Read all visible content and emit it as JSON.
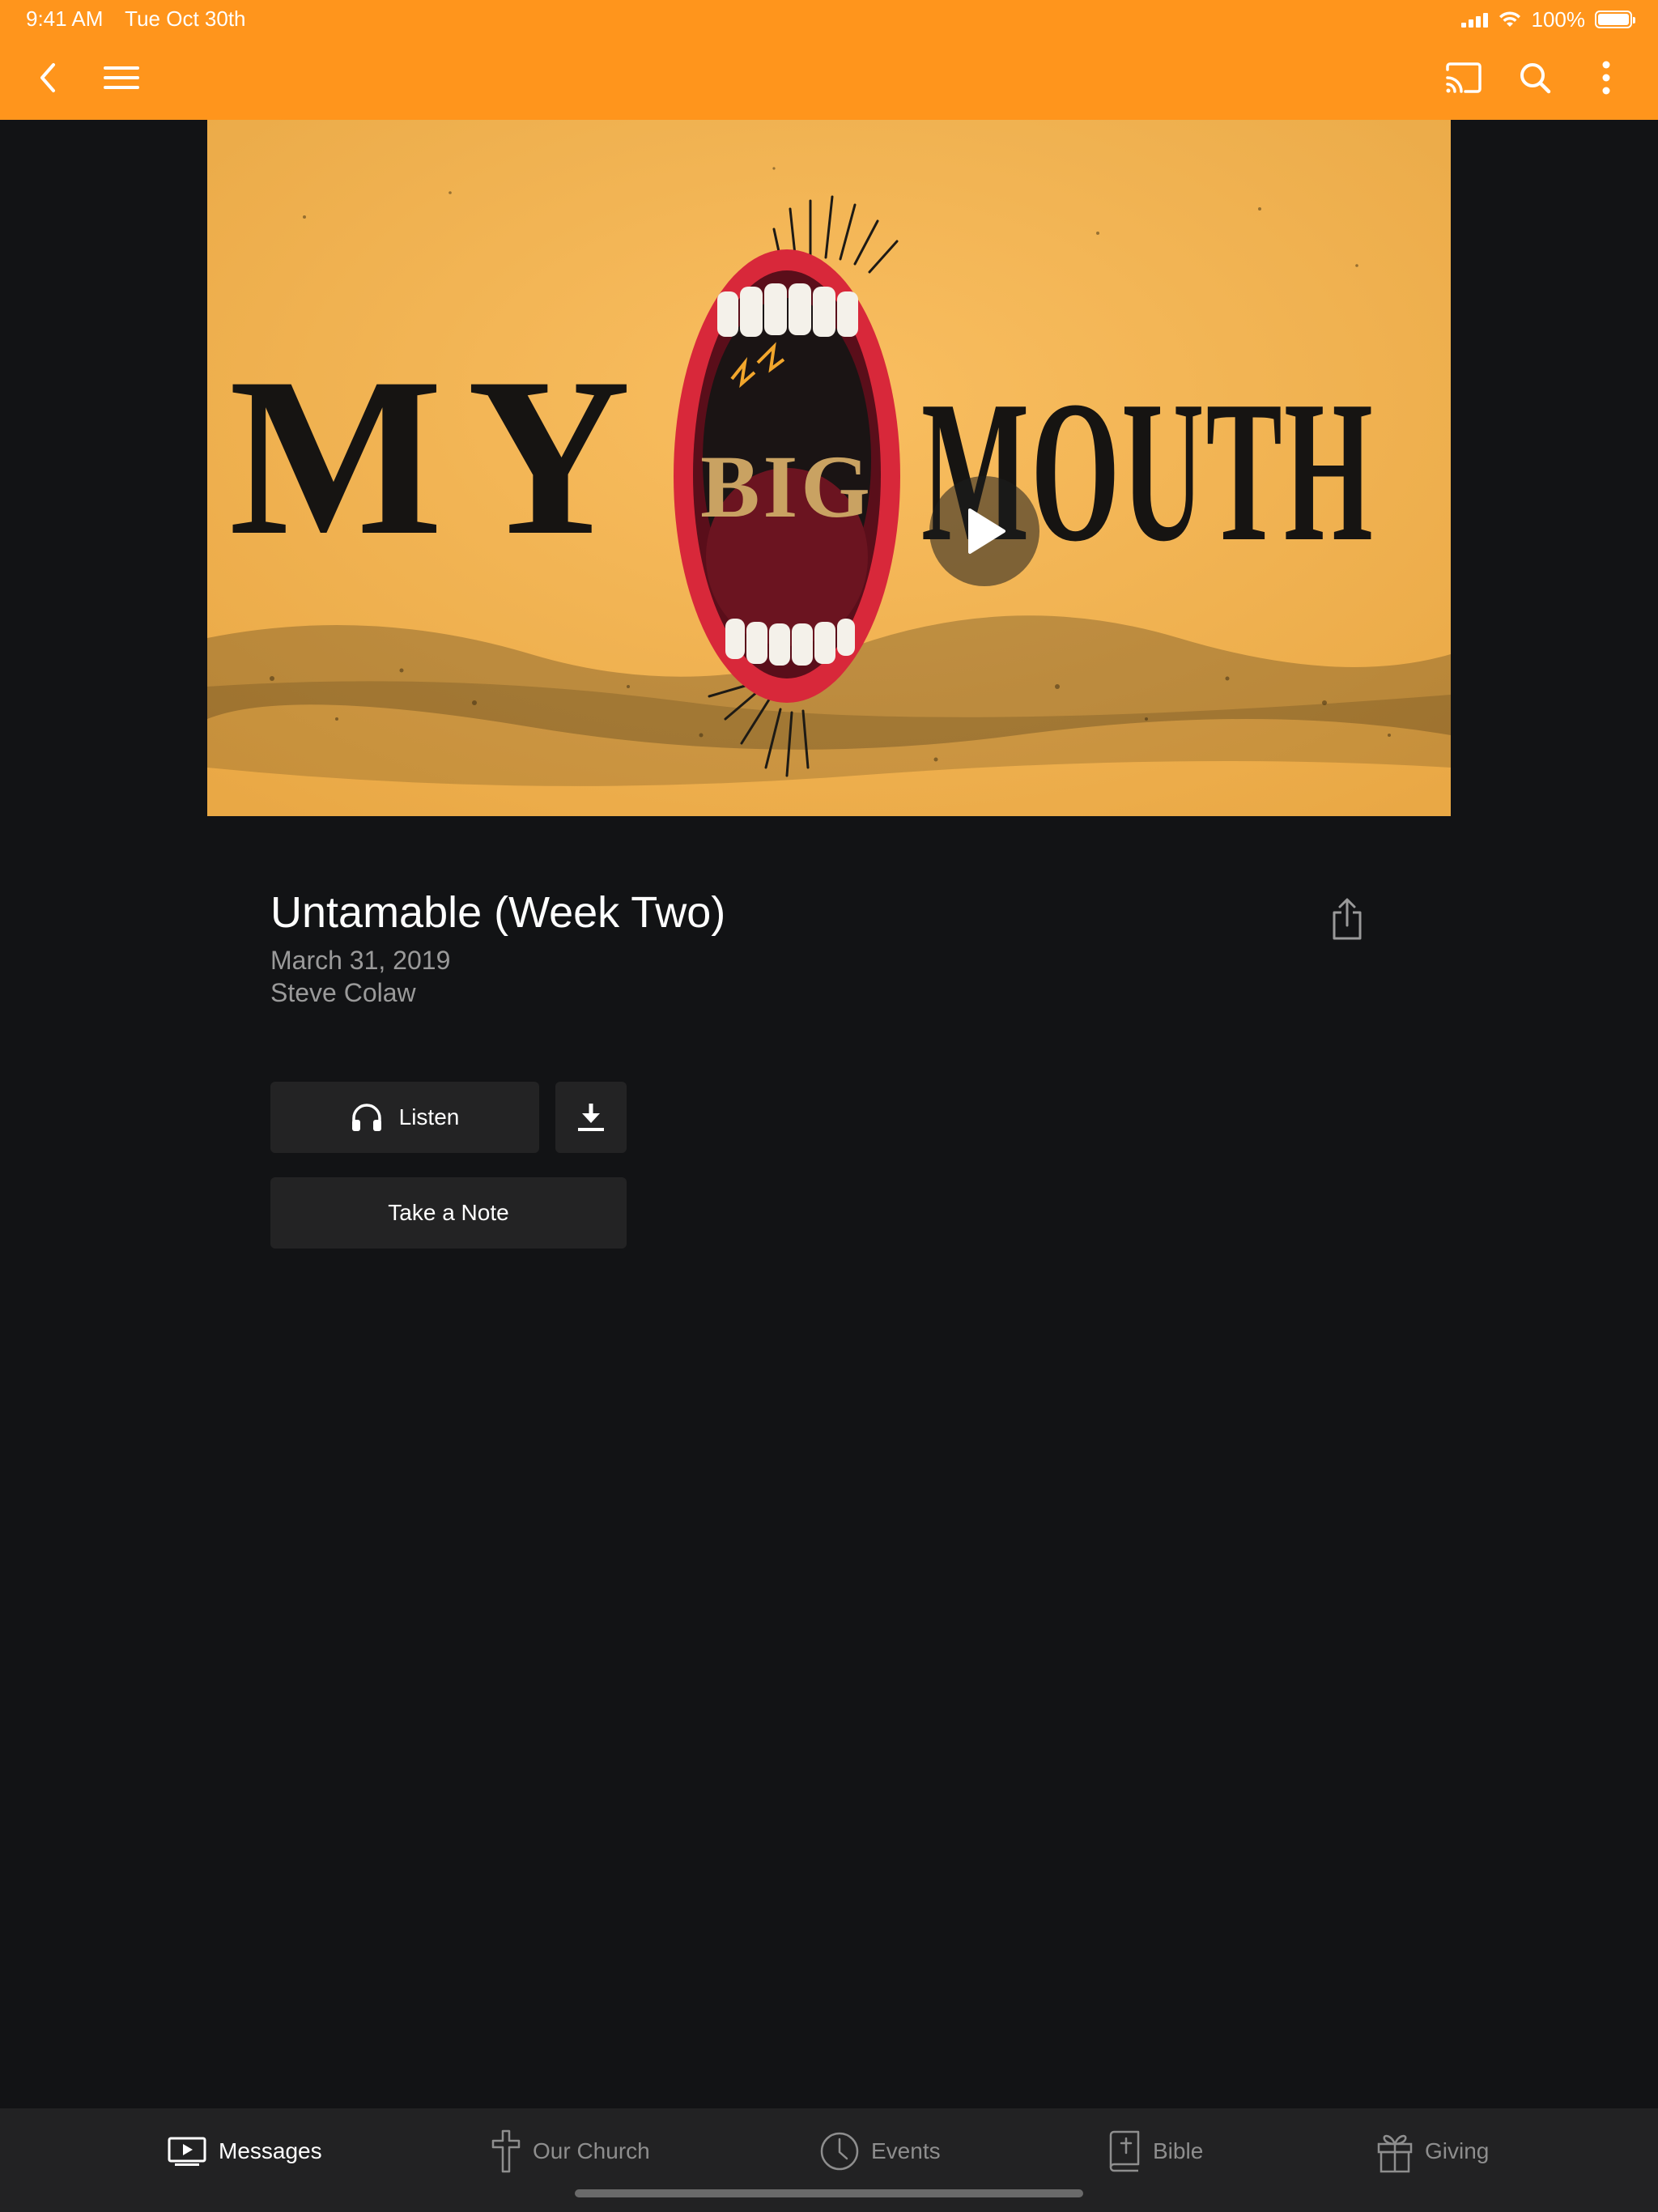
{
  "status_bar": {
    "time": "9:41 AM",
    "date": "Tue Oct 30th",
    "battery": "100%"
  },
  "header": {
    "background": "#ff951c",
    "icons": [
      "back-icon",
      "menu-icon",
      "cast-icon",
      "search-icon",
      "more-vertical-icon"
    ]
  },
  "hero": {
    "art_text": {
      "word1": "MY",
      "word2": "BIG",
      "word3": "MOUTH"
    },
    "icons": [
      "play-icon"
    ]
  },
  "message": {
    "title": "Untamable (Week Two)",
    "date": "March 31, 2019",
    "speaker": "Steve Colaw"
  },
  "actions": {
    "listen_label": "Listen",
    "note_label": "Take a Note",
    "icons": [
      "headphones-icon",
      "download-icon",
      "share-icon"
    ]
  },
  "tabs": [
    {
      "label": "Messages",
      "icon": "video-icon",
      "active": true
    },
    {
      "label": "Our Church",
      "icon": "cross-icon",
      "active": false
    },
    {
      "label": "Events",
      "icon": "clock-icon",
      "active": false
    },
    {
      "label": "Bible",
      "icon": "bible-icon",
      "active": false
    },
    {
      "label": "Giving",
      "icon": "gift-icon",
      "active": false
    }
  ]
}
